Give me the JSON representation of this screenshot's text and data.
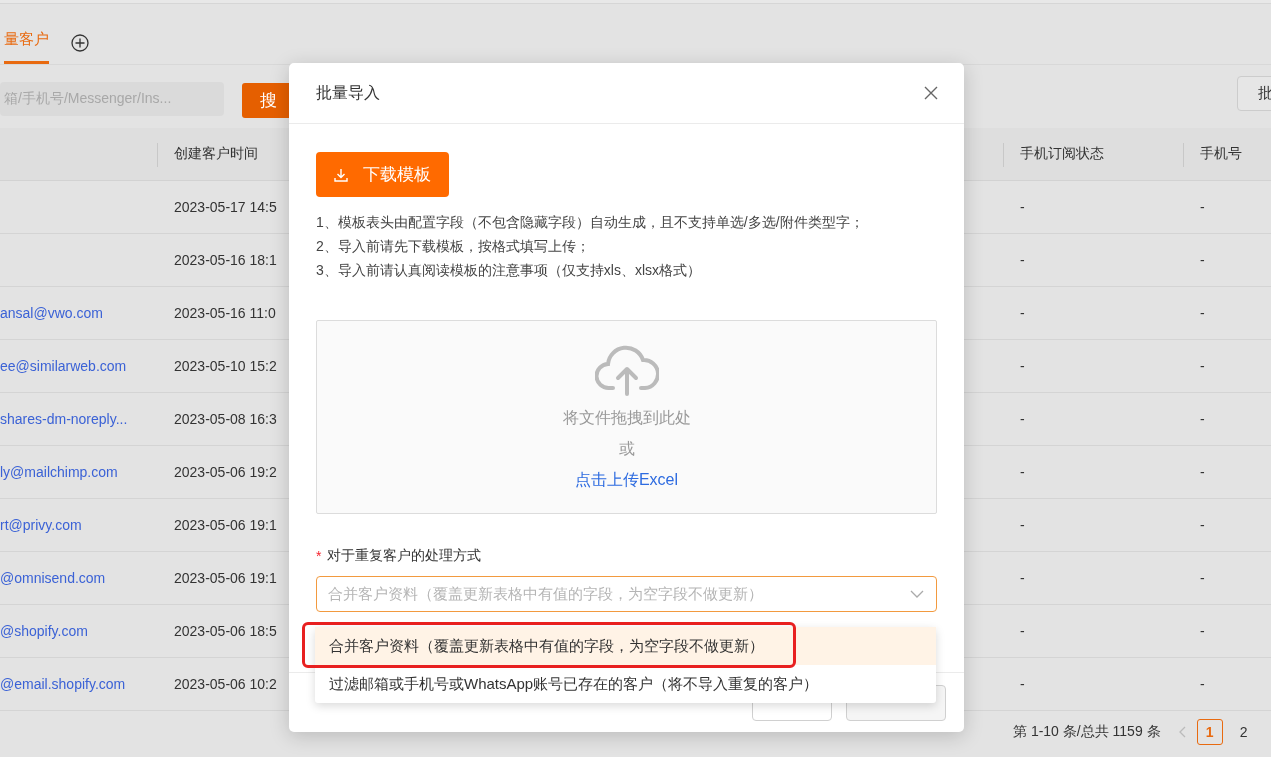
{
  "tabs": [
    {
      "label": "量客户",
      "selected": true
    }
  ],
  "toolbar": {
    "search_placeholder": "箱/手机号/Messenger/Ins...",
    "search_button": "搜",
    "right_button": "批"
  },
  "table": {
    "columns": [
      "创建客户时间",
      "手机订阅状态",
      "手机号"
    ],
    "rows": [
      {
        "created": "2023-05-17 14:5",
        "sms_status": "-",
        "phone": "-"
      },
      {
        "created": "2023-05-16 18:1",
        "sms_status": "-",
        "phone": "-"
      },
      {
        "email": "ansal@vwo.com",
        "created": "2023-05-16 11:0",
        "sms_status": "-",
        "phone": "-"
      },
      {
        "email": "ee@similarweb.com",
        "created": "2023-05-10 15:2",
        "sms_status": "-",
        "phone": "-"
      },
      {
        "email": "shares-dm-noreply...",
        "created": "2023-05-08 16:3",
        "sms_status": "-",
        "phone": "-"
      },
      {
        "email": "ly@mailchimp.com",
        "created": "2023-05-06 19:2",
        "sms_status": "-",
        "phone": "-"
      },
      {
        "email": "rt@privy.com",
        "created": "2023-05-06 19:1",
        "sms_status": "-",
        "phone": "-"
      },
      {
        "email": "@omnisend.com",
        "created": "2023-05-06 19:1",
        "sms_status": "-",
        "phone": "-"
      },
      {
        "email": "@shopify.com",
        "created": "2023-05-06 18:5",
        "sms_status": "-",
        "phone": "-"
      },
      {
        "email": "@email.shopify.com",
        "created": "2023-05-06 10:2",
        "sms_status": "-",
        "phone": "-"
      }
    ]
  },
  "pagination": {
    "summary": "第 1-10 条/总共 1159 条",
    "pages": [
      {
        "label": "1",
        "selected": true
      },
      {
        "label": "2",
        "selected": false
      }
    ]
  },
  "modal": {
    "title": "批量导入",
    "download_button": "下载模板",
    "notes": [
      "1、模板表头由配置字段（不包含隐藏字段）自动生成，且不支持单选/多选/附件类型字；",
      "2、导入前请先下载模板，按格式填写上传；",
      "3、导入前请认真阅读模板的注意事项（仅支持xls、xlsx格式）"
    ],
    "upload": {
      "hint": "将文件拖拽到此处",
      "or": "或",
      "link": "点击上传Excel"
    },
    "field": {
      "label": "对于重复客户的处理方式",
      "required_mark": "*",
      "placeholder": "合并客户资料（覆盖更新表格中有值的字段，为空字段不做更新）"
    },
    "buttons": [
      {
        "disabled": false
      },
      {
        "disabled": true
      }
    ]
  },
  "dropdown": {
    "options": [
      {
        "label": "合并客户资料（覆盖更新表格中有值的字段，为空字段不做更新）",
        "selected": true,
        "highlighted": true
      },
      {
        "label": "过滤邮箱或手机号或WhatsApp账号已存在的客户（将不导入重复的客户）",
        "selected": false,
        "highlighted": false
      }
    ]
  }
}
